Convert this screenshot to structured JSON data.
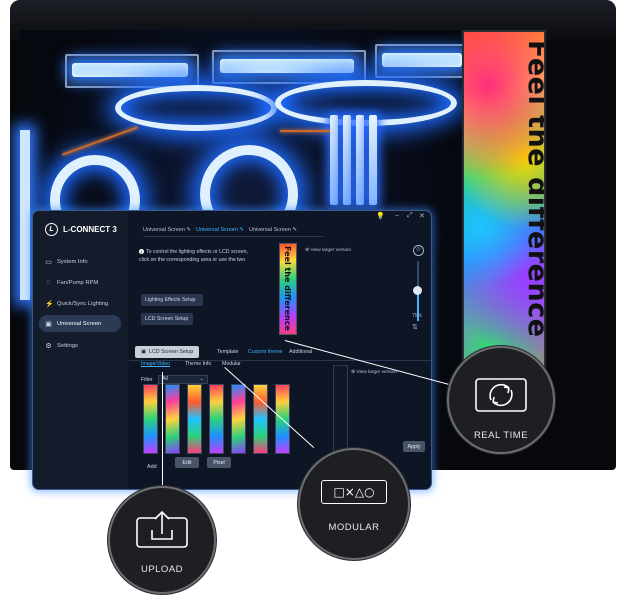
{
  "lcd_banner": "Feel the difference",
  "app": {
    "brand": "L-CONNECT 3",
    "window_controls": [
      "💡",
      "–",
      "⤢",
      "✕"
    ],
    "sidebar": [
      {
        "label": "System Info",
        "icon": "monitor-icon"
      },
      {
        "label": "Fan/Pump RPM",
        "icon": "fan-icon"
      },
      {
        "label": "Quick/Sync Lighting",
        "icon": "bolt-icon"
      },
      {
        "label": "Universal Screen",
        "icon": "screen-icon",
        "active": true
      },
      {
        "label": "Settings",
        "icon": "gear-icon"
      }
    ],
    "top_tabs": [
      {
        "label": "Universal Screen",
        "active": false
      },
      {
        "label": "Universal Screen",
        "active": true
      },
      {
        "label": "Universal Screen",
        "active": false
      }
    ],
    "info_text_1": "To control the lighting effects or LCD screen,",
    "info_text_2": "click on the corresponding area or use the two",
    "lighting_button": "Lighting Effects Setup",
    "lcd_button": "LCD Screen Setup",
    "preview_text": "Feel the difference",
    "view_larger": "View larger version",
    "brightness_value": "75%",
    "subtabs": {
      "active": "LCD Screen Setup",
      "template": "Template",
      "custom_theme": "Custom theme",
      "additional": "Additional"
    },
    "inner_tabs": {
      "image_video": "Image/Video",
      "theme_info": "Theme Info",
      "modular": "Modular"
    },
    "filter_label": "Filter",
    "filter_value": "All",
    "view_larger_2": "View larger version",
    "buttons": {
      "add": "Add",
      "edit": "Edit",
      "pixel": "Pixel",
      "apply": "Apply"
    }
  },
  "badges": {
    "real_time": "REAL TIME",
    "modular": "MODULAR",
    "upload": "UPLOAD",
    "modular_symbols": "□×△○"
  },
  "colors": {
    "accent": "#3fb3ff",
    "window_bg": "#0e1524",
    "badge_bg": "#1e1f22"
  }
}
